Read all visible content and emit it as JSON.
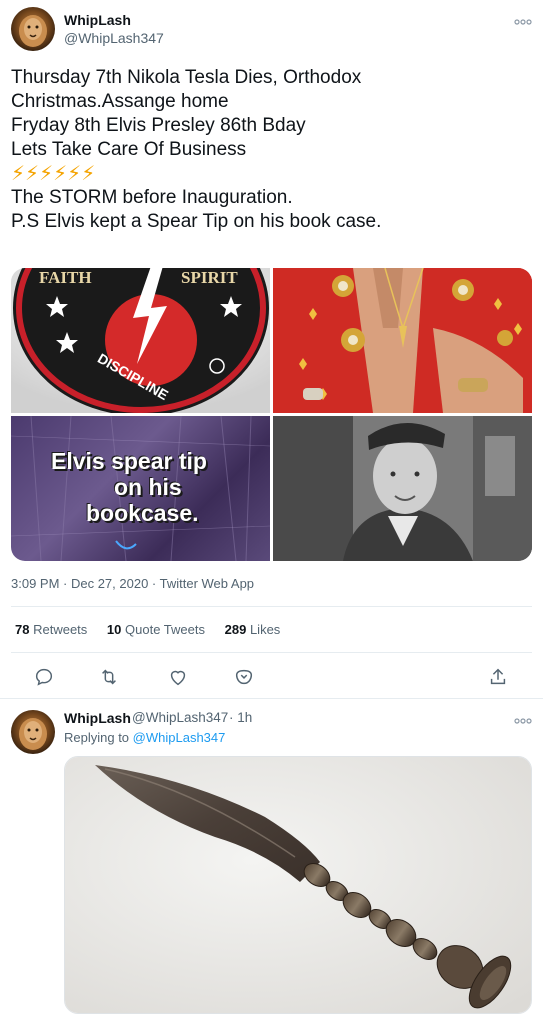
{
  "tweet": {
    "author_name": "WhipLash",
    "author_handle": "@WhipLash347",
    "text_lines": [
      "Thursday 7th Nikola Tesla Dies, Orthodox",
      "Christmas.Assange home",
      "Fryday 8th Elvis Presley 86th Bday",
      "Lets Take Care Of Business",
      "⚡⚡⚡⚡⚡⚡",
      "The STORM before Inauguration.",
      "P.S Elvis kept a Spear Tip on his book case."
    ],
    "media": {
      "patch_top_left": "FAITH",
      "patch_top_right": "SPIRIT",
      "patch_bottom": "DISCIPLINE",
      "overlay_caption_line1": "Elvis spear tip",
      "overlay_caption_line2": "on his",
      "overlay_caption_line3": "bookcase."
    },
    "timestamp": "3:09 PM · Dec 27, 2020 · Twitter Web App",
    "stats": {
      "retweets_count": "78",
      "retweets_label": "Retweets",
      "quotes_count": "10",
      "quotes_label": "Quote Tweets",
      "likes_count": "289",
      "likes_label": "Likes"
    },
    "actions": [
      "reply-icon",
      "retweet-icon",
      "like-icon",
      "share-menu-icon",
      "share-icon"
    ]
  },
  "reply": {
    "author_name": "WhipLash",
    "author_handle": "@WhipLash347",
    "time": "· 1h",
    "replying_prefix": "Replying to",
    "replying_handle": "@WhipLash347"
  },
  "colors": {
    "accent": "#1d9bf0",
    "secondary_text": "#536471",
    "bolt": "#f4a300"
  }
}
